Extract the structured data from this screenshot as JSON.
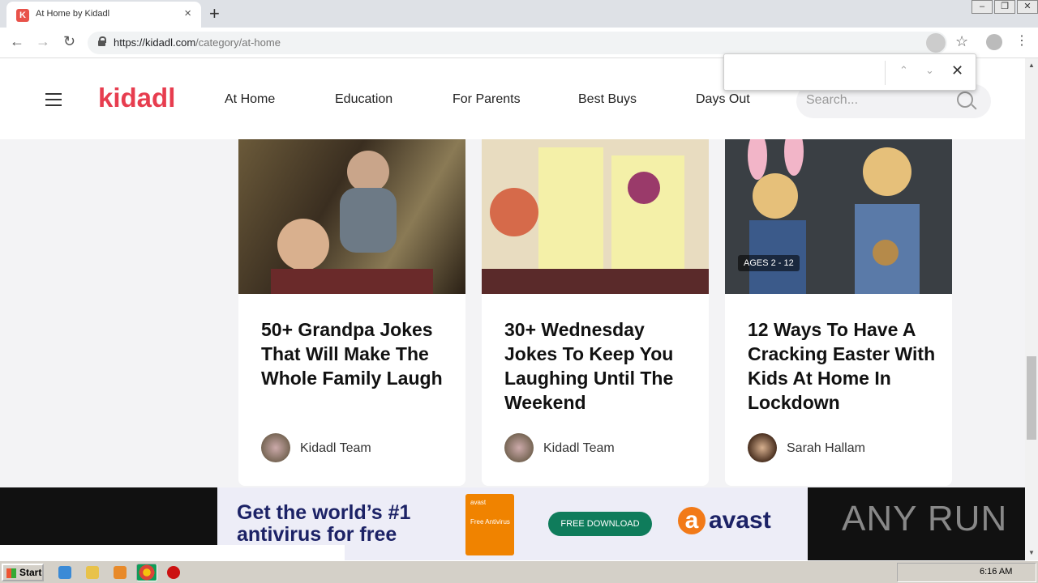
{
  "browser": {
    "tab_title": "At Home by Kidadl",
    "tab_favicon": "K",
    "new_tab": "+",
    "close_tab": "×",
    "url_host": "https://kidadl.com",
    "url_path": "/category/at-home"
  },
  "find_bar": {
    "value": "",
    "prev": "⌃",
    "next": "⌄",
    "close": "✕"
  },
  "site": {
    "logo": "kidadl",
    "nav": [
      "At Home",
      "Education",
      "For Parents",
      "Best Buys",
      "Days Out"
    ],
    "search_placeholder": "Search..."
  },
  "cards": [
    {
      "title": "50+ Grandpa Jokes That Will Make The Whole Family Laugh",
      "author": "Kidadl Team",
      "badge": ""
    },
    {
      "title": "30+ Wednesday Jokes To Keep You Laughing Until The Weekend",
      "author": "Kidadl Team",
      "badge": ""
    },
    {
      "title": "12 Ways To Have A Cracking Easter With Kids At Home In Lockdown",
      "author": "Sarah Hallam",
      "badge": "AGES 2 - 12"
    }
  ],
  "ad": {
    "headline_1": "Get the world’s #1",
    "headline_2": "antivirus for free",
    "box_label": "Free Antivirus",
    "box_brand": "avast",
    "button": "FREE DOWNLOAD",
    "brand": "avast",
    "brand_mark": "a"
  },
  "watermark": "ANY RUN",
  "taskbar": {
    "start": "Start",
    "clock": "6:16 AM"
  }
}
